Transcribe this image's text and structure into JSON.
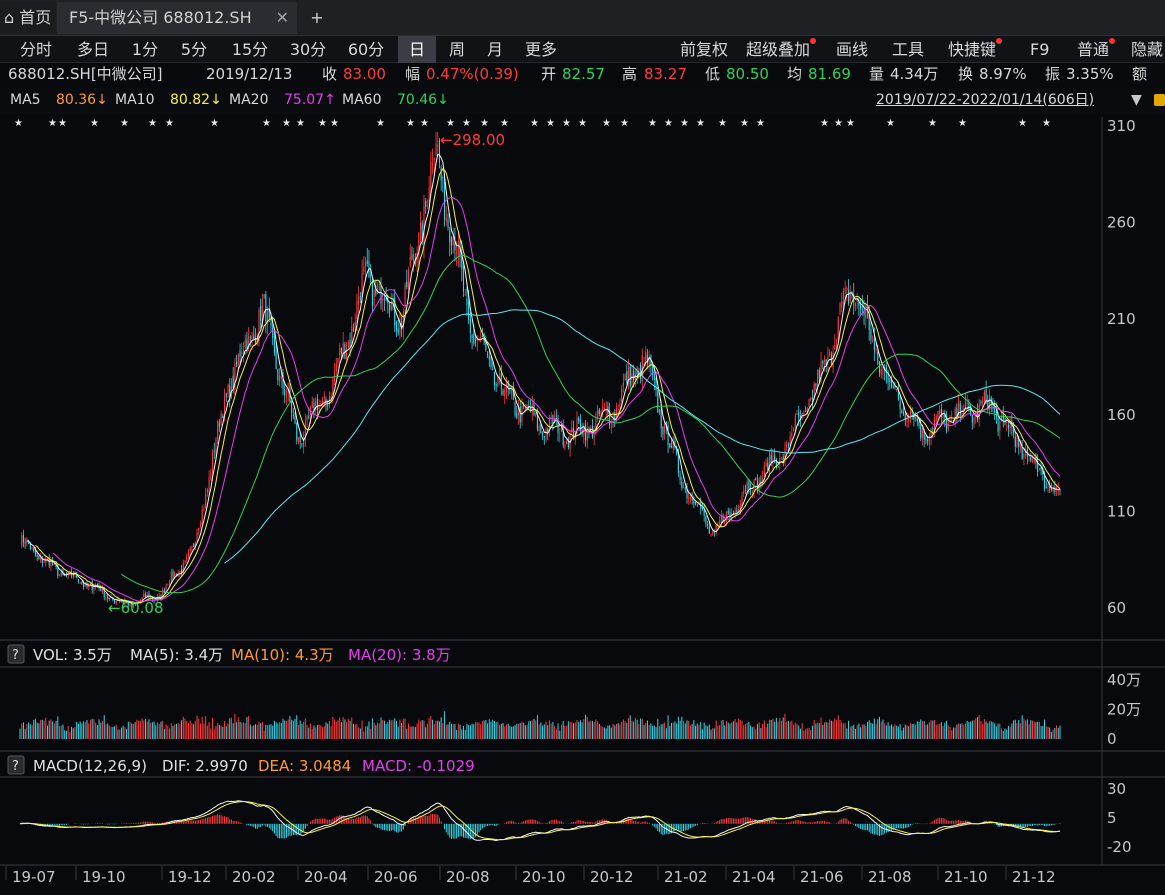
{
  "tabs": {
    "home": "首页",
    "stock": "F5-中微公司 688012.SH",
    "add": "+"
  },
  "periods": [
    "分时",
    "多日",
    "1分",
    "5分",
    "15分",
    "30分",
    "60分",
    "日",
    "周",
    "月",
    "更多"
  ],
  "active_period": "日",
  "tools": [
    {
      "label": "前复权",
      "dot": false
    },
    {
      "label": "超级叠加",
      "dot": true
    },
    {
      "label": "画线",
      "dot": false
    },
    {
      "label": "工具",
      "dot": false
    },
    {
      "label": "快捷键",
      "dot": true
    },
    {
      "label": "F9",
      "dot": false
    },
    {
      "label": "普通",
      "dot": true
    },
    {
      "label": "隐藏",
      "dot": false
    }
  ],
  "quote": {
    "symbol": "688012.SH[中微公司]",
    "date": "2019/12/13",
    "close_label": "收",
    "close": "83.00",
    "change_label": "幅",
    "change": "0.47%(0.39)",
    "open_label": "开",
    "open": "82.57",
    "high_label": "高",
    "high": "83.27",
    "low_label": "低",
    "low": "80.50",
    "avg_label": "均",
    "avg": "81.69",
    "vol_label": "量",
    "vol": "4.34万",
    "turnover_label": "换",
    "turnover": "8.97%",
    "amp_label": "振",
    "amp": "3.35%",
    "amount_label": "额"
  },
  "ma": {
    "ma5": "MA5",
    "ma5_val": "80.36↓",
    "ma10": "MA10",
    "ma10_val": "80.82↓",
    "ma20": "MA20",
    "ma20_val": "75.07↑",
    "ma60": "MA60",
    "ma60_val": "70.46↓"
  },
  "date_range": "2019/07/22-2022/01/14(606日)",
  "vol_panel": {
    "q": "?",
    "vol": "VOL: 3.5万",
    "ma5": "MA(5): 3.4万",
    "ma10": "MA(10): 4.3万",
    "ma20": "MA(20): 3.8万"
  },
  "macd_panel": {
    "q": "?",
    "title": "MACD(12,26,9)",
    "dif": "DIF: 2.9970",
    "dea": "DEA: 3.0484",
    "macd": "MACD: -0.1029"
  },
  "price_axis": [
    "310",
    "260",
    "210",
    "160",
    "110",
    "60"
  ],
  "vol_axis": [
    "40万",
    "20万",
    "0"
  ],
  "macd_axis": [
    "30",
    "5",
    "-20"
  ],
  "x_labels": [
    "19-07",
    "19-10",
    "19-12",
    "20-02",
    "20-04",
    "20-06",
    "20-08",
    "20-10",
    "20-12",
    "21-02",
    "21-04",
    "21-06",
    "21-08",
    "21-10",
    "21-12"
  ],
  "annotations": {
    "high": "298.00",
    "low": "60.08"
  },
  "chart_data": {
    "type": "candlestick",
    "range": "2019/07/22-2022/01/14",
    "ylim": [
      60,
      310
    ],
    "price_key_points": [
      {
        "month": "19-07",
        "price": 95
      },
      {
        "month": "19-08",
        "price": 80
      },
      {
        "month": "19-09",
        "price": 72
      },
      {
        "month": "19-10",
        "price": 62
      },
      {
        "month": "19-11",
        "price": 66
      },
      {
        "month": "19-12",
        "price": 90
      },
      {
        "month": "20-01",
        "price": 175
      },
      {
        "month": "20-02",
        "price": 215
      },
      {
        "month": "20-03",
        "price": 148
      },
      {
        "month": "20-04",
        "price": 175
      },
      {
        "month": "20-05",
        "price": 232
      },
      {
        "month": "20-06",
        "price": 210
      },
      {
        "month": "20-07",
        "price": 298
      },
      {
        "month": "20-08",
        "price": 205
      },
      {
        "month": "20-09",
        "price": 170
      },
      {
        "month": "20-10",
        "price": 155
      },
      {
        "month": "20-11",
        "price": 150
      },
      {
        "month": "20-12",
        "price": 160
      },
      {
        "month": "21-01",
        "price": 190
      },
      {
        "month": "21-02",
        "price": 130
      },
      {
        "month": "21-03",
        "price": 98
      },
      {
        "month": "21-04",
        "price": 122
      },
      {
        "month": "21-05",
        "price": 140
      },
      {
        "month": "21-06",
        "price": 175
      },
      {
        "month": "21-07",
        "price": 228
      },
      {
        "month": "21-08",
        "price": 178
      },
      {
        "month": "21-09",
        "price": 152
      },
      {
        "month": "21-10",
        "price": 160
      },
      {
        "month": "21-11",
        "price": 165
      },
      {
        "month": "21-12",
        "price": 140
      },
      {
        "month": "22-01",
        "price": 118
      }
    ],
    "high": 298.0,
    "low": 60.08,
    "vol_ylim": [
      0,
      40
    ],
    "macd_ylim": [
      -20,
      30
    ]
  }
}
